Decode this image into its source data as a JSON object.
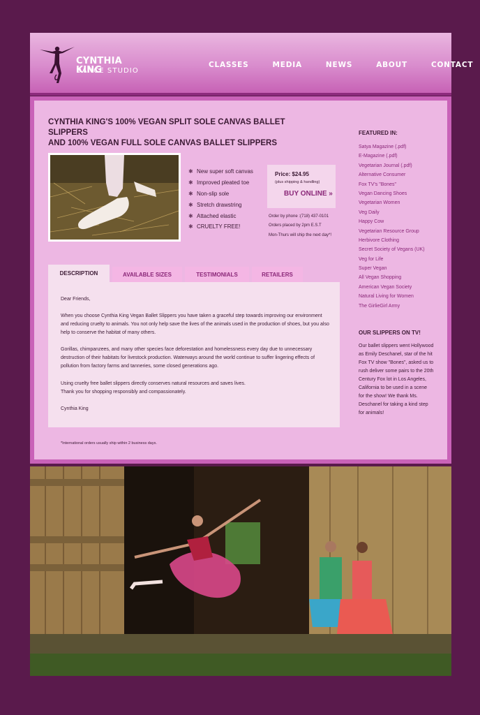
{
  "header": {
    "brand_name": "CYNTHIA KING",
    "brand_sub": "DANCE STUDIO",
    "nav": [
      "CLASSES",
      "MEDIA",
      "NEWS",
      "ABOUT",
      "CONTACT"
    ]
  },
  "product": {
    "title_line1": "CYNTHIA KING'S 100% VEGAN SPLIT SOLE CANVAS BALLET SLIPPERS",
    "title_line2": "AND 100% VEGAN FULL SOLE CANVAS BALLET SLIPPERS",
    "features": [
      "New super soft canvas",
      "Improved pleated toe",
      "Non-slip sole",
      "Stretch drawstring",
      "Attached elastic",
      "CRUELTY FREE!"
    ],
    "price": "Price: $24.95",
    "price_note": "(plus shipping & handling)",
    "buy_label": "BUY ONLINE »",
    "order_line1": "Order by phone :(718) 437-0101",
    "order_line2": "Orders placed by 2pm E.S.T",
    "order_line3": "Mon-Thurs will ship the next day*!"
  },
  "tabs": [
    "DESCRIPTION",
    "AVAILABLE SIZES",
    "TESTIMONIALS",
    "RETAILERS"
  ],
  "description": {
    "greeting": "Dear Friends,",
    "p1": "When you choose Cynthia King Vegan Ballet Slippers you have taken a graceful step towards improving our environment and reducing cruelty to animals. You not only help save the lives of the animals used in the production of shoes, but you also help to conserve the habitat of many others.",
    "p2": "Gorillas, chimpanzees, and many other species face deforestation and homelessness every day due to unnecessary destruction of their habitats for livestock production. Waterways around the world continue to suffer lingering effects of pollution from factory farms and tanneries, some closed generations ago.",
    "p3_line1": "Using cruelty free ballet slippers directly conserves natural resources and saves lives.",
    "p3_line2": "Thank you for shopping responsibly and compassionately.",
    "signature": "Cynthia King"
  },
  "footnote": "*International orders usually ship within 2 business days.",
  "sidebar": {
    "featured_heading": "FEATURED IN:",
    "featured": [
      "Satya Magazine (.pdf)",
      "E-Magazine (.pdf)",
      "Vegetarian Journal (.pdf)",
      "Alternative Consumer",
      "Fox TV's \"Bones\"",
      "Vegan Dancing Shoes",
      "Vegetarian Women",
      "Veg Daily",
      "Happy Cow",
      "Vegetarian Resource Group",
      "Herbivore Clothing",
      "Secret Society of Vegans (UK)",
      "Veg for Life",
      "Super Vegan",
      "All Vegan Shopping",
      "American Vegan Society",
      "Natural Living for Women",
      "The GirlieGirl Army"
    ],
    "tv_heading": "OUR SLIPPERS ON TV!",
    "tv_text": "Our ballet slippers went Hollywood as Emily Deschanel, star of the hit Fox TV show \"Bones\", asked us to rush deliver some pairs to the 20th Century Fox lot in Los Angeles, California to be used in a scene for the show! We thank Ms. Deschanel for taking a kind step for animals!"
  }
}
